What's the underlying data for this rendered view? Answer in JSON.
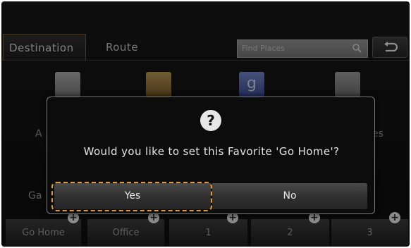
{
  "tabs": [
    {
      "label": "Destination",
      "active": true
    },
    {
      "label": "Route",
      "active": false
    }
  ],
  "search": {
    "placeholder": "Find Places",
    "icon": "search-icon"
  },
  "back": {
    "icon": "back-arrow-icon"
  },
  "background_labels": {
    "left_partial_top": "A",
    "right_partial_top": "es",
    "left_partial_bottom": "Ga"
  },
  "favorites": [
    {
      "label": "Go Home"
    },
    {
      "label": "Office"
    },
    {
      "label": "1"
    },
    {
      "label": "2"
    },
    {
      "label": "3"
    }
  ],
  "dialog": {
    "icon": "question-icon",
    "icon_glyph": "?",
    "message": "Would you like to set this Favorite 'Go Home'?",
    "yes_label": "Yes",
    "no_label": "No"
  },
  "colors": {
    "focus": "#e39a3a",
    "background": "#121212"
  }
}
